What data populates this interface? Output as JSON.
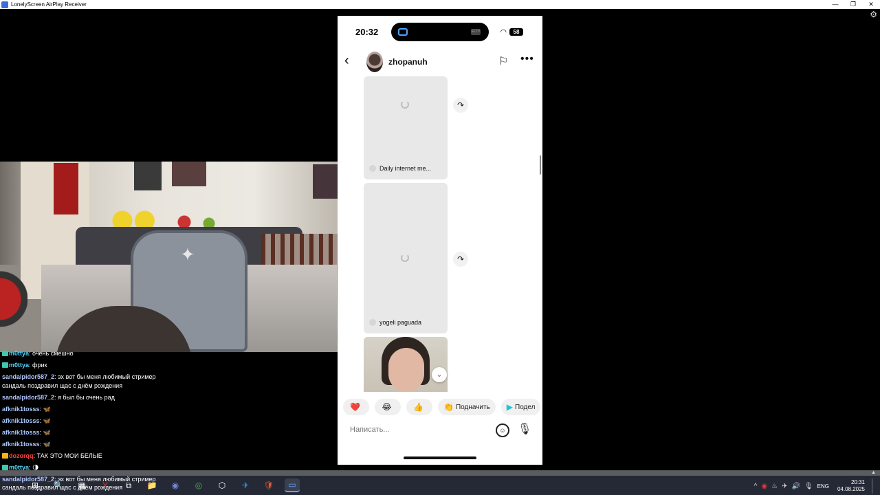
{
  "window": {
    "title": "LonelyScreen AirPlay Receiver",
    "controls": [
      "—",
      "❐",
      "✕"
    ]
  },
  "chat": {
    "messages": [
      {
        "user": "m0ttya",
        "text": "очень смешно",
        "badge": "teal",
        "user_color": "#5ad7ff"
      },
      {
        "user": "m0ttya",
        "text": "фрик",
        "badge": "teal",
        "user_color": "#5ad7ff"
      },
      {
        "user": "sandalpidor587_2",
        "text": "эх вот бы меня любимый стример",
        "badge": "",
        "user_color": "#b5c7ff"
      },
      {
        "user": "",
        "text": "сандаль поздравил щас с днём рождения",
        "badge": "",
        "user_color": ""
      },
      {
        "user": "sandalpidor587_2",
        "text": "я был бы очень рад",
        "badge": "",
        "user_color": "#b5c7ff"
      },
      {
        "user": "afknik1tosss",
        "text": "🦋",
        "badge": "",
        "user_color": "#a9c9ff"
      },
      {
        "user": "afknik1tosss",
        "text": "🦋",
        "badge": "",
        "user_color": "#a9c9ff"
      },
      {
        "user": "afknik1tosss",
        "text": "🦋",
        "badge": "",
        "user_color": "#a9c9ff"
      },
      {
        "user": "afknik1tosss",
        "text": "🦋",
        "badge": "",
        "user_color": "#a9c9ff"
      },
      {
        "user": "dozorqq",
        "text": "ТАК ЭТО МОИ БЕЛЫЕ",
        "badge": "crown",
        "user_color": "#ff4040"
      },
      {
        "user": "m0ttya",
        "text": "🌗",
        "badge": "teal",
        "user_color": "#5ad7ff"
      },
      {
        "user": "sandalpidor587_2",
        "text": "эх вот бы меня любимый стример",
        "badge": "",
        "user_color": "#b5c7ff"
      },
      {
        "user": "",
        "text": "сандаль поздравил щас с днём рождения",
        "badge": "",
        "user_color": ""
      }
    ]
  },
  "phone": {
    "status": {
      "time": "20:32",
      "battery": "58",
      "island_right": "ELTV"
    },
    "header": {
      "back_icon": "‹",
      "username": "zhopanuh",
      "flag_icon": "⚐",
      "more_icon": "•••"
    },
    "cards": [
      {
        "caption": "Daily internet me..."
      },
      {
        "caption": "yogeli paguada"
      }
    ],
    "share_icon": "↷",
    "scroll_down_icon": "⌄",
    "reactions": [
      {
        "emoji": "❤️",
        "label": ""
      },
      {
        "emoji": "😂",
        "label": ""
      },
      {
        "emoji": "👍",
        "label": ""
      },
      {
        "emoji": "👏",
        "label": "Подначить"
      },
      {
        "emoji": "▶",
        "label": "Подел"
      }
    ],
    "composer": {
      "placeholder": "Написать...",
      "sticker_icon": "☺",
      "mic_icon": "🎙"
    }
  },
  "taskbar": {
    "apps": [
      "⊞",
      "🔍",
      "▦",
      "Y",
      "⧉",
      "📁",
      "◉",
      "◎",
      "⬡",
      "✈",
      "🛡",
      "▭"
    ],
    "tray": {
      "language": "ENG",
      "time": "20:31",
      "date": "04.08.2025",
      "icons": [
        "^",
        "◉",
        "♨",
        "✈",
        "🔊",
        "🎙"
      ]
    }
  },
  "colors": {
    "accent_pink": "#e0306a",
    "taskbar_bg": "#252935",
    "window_bg": "#000000"
  }
}
